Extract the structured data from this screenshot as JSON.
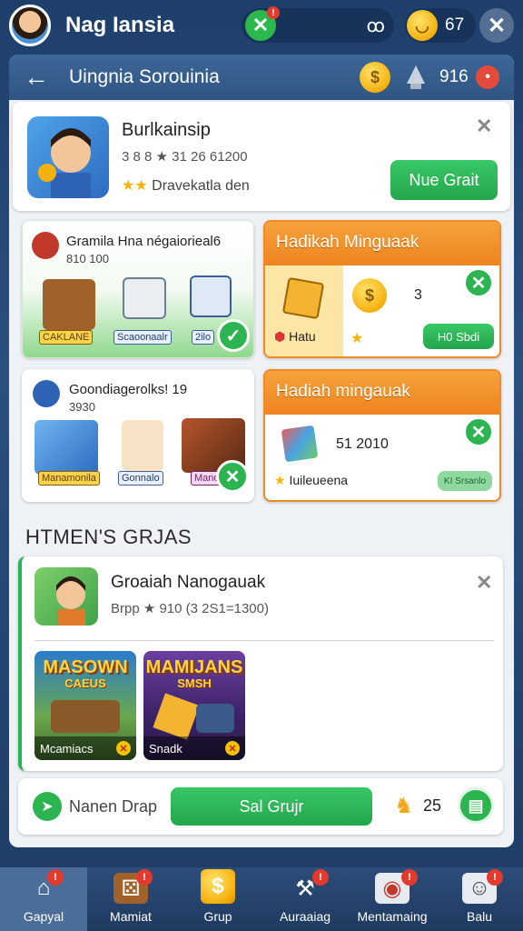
{
  "topbar": {
    "title": "Nag Iansia",
    "currency_value": "67",
    "notif_badge": "!"
  },
  "header": {
    "title": "Uingnia Sorouinia",
    "points": "916"
  },
  "featured": {
    "title": "Burlkainsip",
    "meta": "3 8 8 ★ 31 26 61200",
    "rating_label": "Dravekatla den",
    "button": "Nue Grait"
  },
  "card_green": {
    "title": "Gramila Hna négaiorieal6",
    "sub": "810 100",
    "labels": [
      "CAKLANE",
      "Scaoonaalr",
      "2ilo"
    ]
  },
  "card_orange1": {
    "header": "Hadikah Minguaak",
    "value": "3",
    "item_label": "Hatu",
    "button": "H0 Sbdi"
  },
  "card_white": {
    "title": "Goondiagerolks! 19",
    "sub": "3930",
    "labels": [
      "Manamonila",
      "Gonnalo",
      "Manoumo"
    ]
  },
  "card_orange2": {
    "header": "Hadiah mingauak",
    "value": "51 2010",
    "item_label": "Iuileueena",
    "button": "KI Srsanlo"
  },
  "section": {
    "title": "HTMEN'S GRJAS"
  },
  "group": {
    "title": "Groaiah Nanogauak",
    "meta": "Brpp ★ 910 (3 2S1=1300)",
    "games": [
      {
        "title": "MASOWN",
        "sub": "CAEUS",
        "label": "Mcamiacs"
      },
      {
        "title": "MAMIJANS",
        "sub": "SMSH",
        "label": "Snadk"
      }
    ]
  },
  "bottom": {
    "label": "Nanen Drap",
    "button": "Sal Grujr",
    "value": "25"
  },
  "nav": [
    {
      "label": "Gapyal",
      "icon": "home-icon",
      "badge": "!"
    },
    {
      "label": "Mamiat",
      "icon": "dice-icon",
      "badge": "!"
    },
    {
      "label": "Grup",
      "icon": "coin-icon",
      "badge": ""
    },
    {
      "label": "Auraaiag",
      "icon": "tool-icon",
      "badge": "!"
    },
    {
      "label": "Mentamaing",
      "icon": "message-icon",
      "badge": "!"
    },
    {
      "label": "Balu",
      "icon": "bag-icon",
      "badge": "!"
    }
  ],
  "colors": {
    "accent_green": "#2bb44f",
    "accent_orange": "#f08a24",
    "header_blue": "#2f5583",
    "badge_red": "#e23b2e"
  }
}
